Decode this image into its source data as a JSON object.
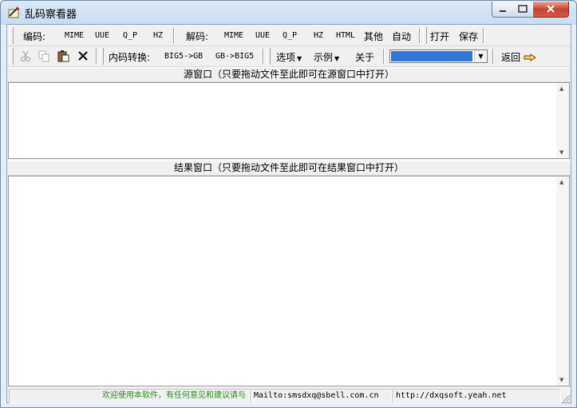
{
  "window": {
    "title": "乱码察看器"
  },
  "toolbar1": {
    "encode_label": "编码:",
    "encode_buttons": [
      "MIME",
      "UUE",
      "Q_P",
      "HZ"
    ],
    "decode_label": "解码:",
    "decode_buttons": [
      "MIME",
      "UUE",
      "Q_P",
      "HZ",
      "HTML"
    ],
    "other_label": "其他",
    "auto_label": "自动",
    "open_label": "打开",
    "save_label": "保存"
  },
  "toolbar2": {
    "icons": [
      "cut-icon",
      "copy-icon",
      "paste-icon",
      "delete-icon"
    ],
    "convert_label": "内码转换:",
    "big5_to_gb": "BIG5->GB",
    "gb_to_big5": "GB->BIG5",
    "options_label": "选项",
    "examples_label": "示例",
    "about_label": "关于",
    "combo_selected": "",
    "back_label": "返回"
  },
  "source_pane": {
    "header": "源窗口（只要拖动文件至此即可在源窗口中打开）",
    "content": ""
  },
  "result_pane": {
    "header": "结果窗口（只要拖动文件至此即可在结果窗口中打开）",
    "content": ""
  },
  "status": {
    "welcome": "欢迎使用本软件，有任何意见和建议请与",
    "mail": "Mailto:smsdxq@sbell.com.cn",
    "web": "http://dxqsoft.yeah.net"
  },
  "colors": {
    "accent": "#3078d8",
    "status_green": "#2b8a1e",
    "close_button": "#c7432f"
  }
}
